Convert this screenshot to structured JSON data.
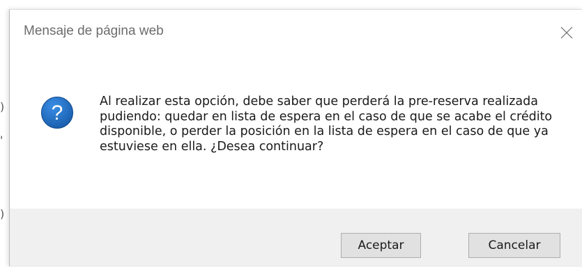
{
  "dialog": {
    "title": "Mensaje de página web",
    "message": "Al realizar esta opción, debe saber que perderá la pre-reserva realizada pudiendo: quedar en lista de espera en el caso de que se acabe el crédito disponible, o perder la posición en la lista de espera en el caso de que ya estuviese en ella. ¿Desea continuar?",
    "accept_label": "Aceptar",
    "cancel_label": "Cancelar",
    "icon": "question-icon",
    "close_icon": "close-icon"
  },
  "colors": {
    "icon_blue": "#1e6fbf",
    "footer_bg": "#f0f0f0",
    "button_bg": "#e1e1e1",
    "title_text": "#6c6c6c"
  }
}
